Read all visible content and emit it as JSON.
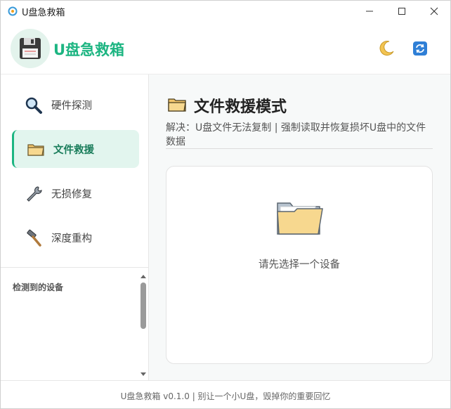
{
  "window": {
    "title": "U盘急救箱",
    "minimize": "minimize",
    "maximize": "maximize",
    "close": "close"
  },
  "header": {
    "brand": "U盘急救箱",
    "logo_icon": "floppy-disk-icon",
    "theme_icon": "moon-icon",
    "refresh_icon": "refresh-icon"
  },
  "sidebar": {
    "items": [
      {
        "label": "硬件探测",
        "icon": "magnifier-icon",
        "active": false
      },
      {
        "label": "文件救援",
        "icon": "folder-icon",
        "active": true
      },
      {
        "label": "无损修复",
        "icon": "wrench-icon",
        "active": false
      },
      {
        "label": "深度重构",
        "icon": "hammer-icon",
        "active": false
      }
    ],
    "devices_label": "检测到的设备"
  },
  "main": {
    "title": "文件救援模式",
    "description": "解决：U盘文件无法复制 | 强制读取并恢复损坏U盘中的文件数据",
    "empty_state": "请先选择一个设备"
  },
  "footer": {
    "text": "U盘急救箱 v0.1.0   |   别让一个小U盘，毁掉你的重要回忆"
  },
  "colors": {
    "accent": "#1db582",
    "active_bg": "#e2f5ee",
    "main_bg": "#f7f9f9"
  }
}
